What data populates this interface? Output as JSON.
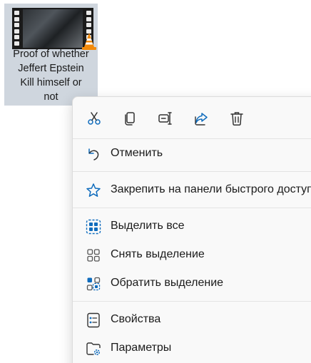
{
  "file": {
    "name": "Proof of whether\nJeffert Epstein\nKill himself or\nnot",
    "thumbnail_icon": "vlc-video-thumbnail"
  },
  "context_menu": {
    "toolbar": [
      {
        "name": "cut-icon"
      },
      {
        "name": "copy-icon"
      },
      {
        "name": "rename-icon"
      },
      {
        "name": "share-icon"
      },
      {
        "name": "delete-icon"
      }
    ],
    "items": [
      {
        "label": "Отменить",
        "icon": "undo-icon"
      },
      {
        "label": "Закрепить на панели быстрого доступа",
        "icon": "star-icon"
      },
      {
        "label": "Выделить все",
        "icon": "select-all-icon"
      },
      {
        "label": "Снять выделение",
        "icon": "select-none-icon"
      },
      {
        "label": "Обратить выделение",
        "icon": "invert-selection-icon"
      },
      {
        "label": "Свойства",
        "icon": "properties-icon"
      },
      {
        "label": "Параметры",
        "icon": "folder-options-icon"
      }
    ]
  },
  "colors": {
    "accent": "#0f6cbd",
    "selection_bg": "#cfd6de",
    "menu_bg": "#f9f9f9"
  }
}
